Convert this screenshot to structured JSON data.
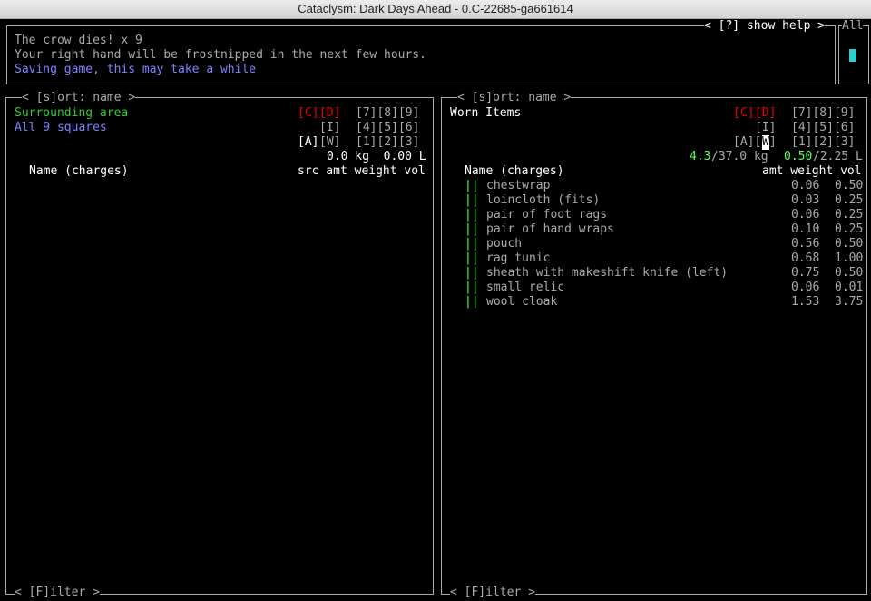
{
  "window": {
    "title": "Cataclysm: Dark Days Ahead - 0.C-22685-ga661614"
  },
  "messages": {
    "show_help": "< [?] show help >",
    "all": "All",
    "lines": [
      "The crow dies! x 9",
      "Your right hand will be frostnipped in the next few hours.",
      "Saving game, this may take a while"
    ]
  },
  "left_pane": {
    "sort": "< [s]ort: name >",
    "title": "Surrounding area",
    "subtitle": "All 9 squares",
    "keys_row1": {
      "c": "[C]",
      "d": "[D]",
      "rest": "[7][8][9]"
    },
    "keys_row2": {
      "i": "[I]",
      "rest": "[4][5][6]"
    },
    "keys_row3": {
      "a": "[A]",
      "w": "[W]",
      "rest": "[1][2][3]"
    },
    "weight_volume": "0.0 kg  0.00 L",
    "col_name": "Name (charges)",
    "col_right": "src amt weight vol",
    "filter": "< [F]ilter >"
  },
  "right_pane": {
    "sort": "< [s]ort: name >",
    "title": "Worn Items",
    "keys_row1": {
      "c": "[C]",
      "d": "[D]",
      "rest": "[7][8][9]"
    },
    "keys_row2": {
      "i": "[I]",
      "rest": "[4][5][6]"
    },
    "keys_row3": {
      "a": "[A][",
      "w": "W",
      "close": "]",
      "rest": "[1][2][3]"
    },
    "weight_cur": "4.3",
    "weight_max": "/37.0 kg",
    "vol_cur": "0.50",
    "vol_max": "/2.25 L",
    "col_name": "Name (charges)",
    "col_right": "amt weight vol",
    "filter": "< [F]ilter >",
    "items": [
      {
        "bar": "||",
        "name": "chestwrap",
        "weight": "0.06",
        "vol": "0.50"
      },
      {
        "bar": "||",
        "name": "loincloth (fits)",
        "weight": "0.03",
        "vol": "0.25"
      },
      {
        "bar": "||",
        "name": "pair of foot rags",
        "weight": "0.06",
        "vol": "0.25"
      },
      {
        "bar": "||",
        "name": "pair of hand wraps",
        "weight": "0.10",
        "vol": "0.25"
      },
      {
        "bar": "||",
        "name": "pouch",
        "weight": "0.56",
        "vol": "0.50"
      },
      {
        "bar": "||",
        "name": "rag tunic",
        "weight": "0.68",
        "vol": "1.00"
      },
      {
        "bar": "||",
        "name": "sheath with makeshift knife (left)",
        "weight": "0.75",
        "vol": "0.50"
      },
      {
        "bar": "||",
        "name": "small relic",
        "weight": "0.06",
        "vol": "0.01"
      },
      {
        "bar": "||",
        "name": "wool cloak",
        "weight": "1.53",
        "vol": "3.75"
      }
    ]
  }
}
